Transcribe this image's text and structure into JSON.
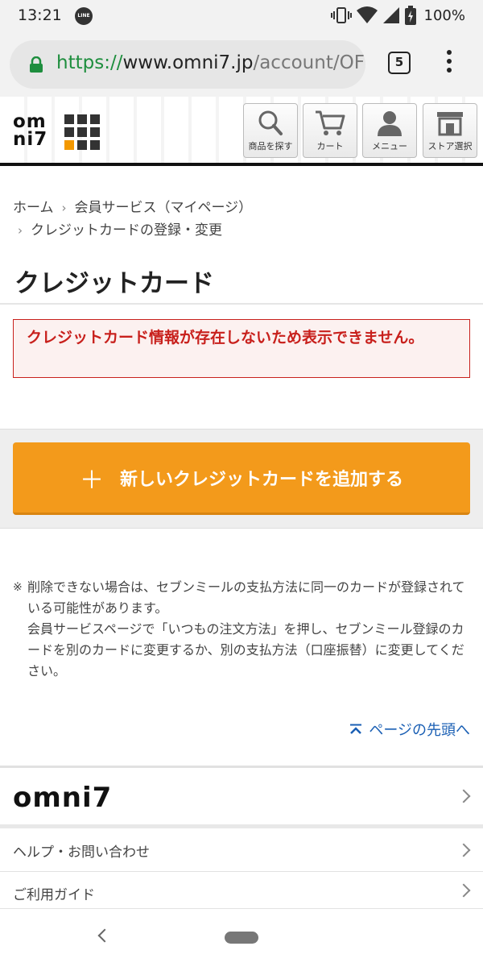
{
  "status_bar": {
    "time": "13:21",
    "line_badge": "LINE",
    "battery": "100%",
    "icons": [
      "line-app-icon",
      "vibrate-icon",
      "wifi-icon",
      "cell-signal-icon",
      "battery-charging-icon"
    ]
  },
  "browser": {
    "url_scheme": "https://",
    "url_host": "www.omni7.jp",
    "url_path": "/account/OF",
    "tab_count": "5"
  },
  "header": {
    "logo_line1": "om",
    "logo_line2": "ni7",
    "buttons": [
      {
        "label": "商品を探す",
        "icon": "search-icon"
      },
      {
        "label": "カート",
        "icon": "cart-icon"
      },
      {
        "label": "メニュー",
        "icon": "user-icon"
      },
      {
        "label": "ストア選択",
        "icon": "store-icon"
      }
    ]
  },
  "breadcrumb": {
    "items": [
      "ホーム",
      "会員サービス（マイページ）",
      "クレジットカードの登録・変更"
    ]
  },
  "page": {
    "title": "クレジットカード",
    "alert": "クレジットカード情報が存在しないため表示できません。",
    "add_button_label": "新しいクレジットカードを追加する",
    "add_button_plus": "＋",
    "note_mark": "※",
    "note_text": "削除できない場合は、セブンミールの支払方法に同一のカードが登録されている可能性があります。\n会員サービスページで「いつもの注文方法」を押し、セブンミール登録のカードを別のカードに変更するか、別の支払方法（口座振替）に変更してください。",
    "page_top": "ページの先頭へ"
  },
  "footer": {
    "brand": "omni7",
    "links": [
      "ヘルプ・お問い合わせ",
      "ご利用ガイド"
    ]
  },
  "colors": {
    "accent_orange": "#f39a1b",
    "alert_red": "#c8201c",
    "link_blue": "#1a5fb4",
    "secure_green": "#1e8e3e"
  }
}
